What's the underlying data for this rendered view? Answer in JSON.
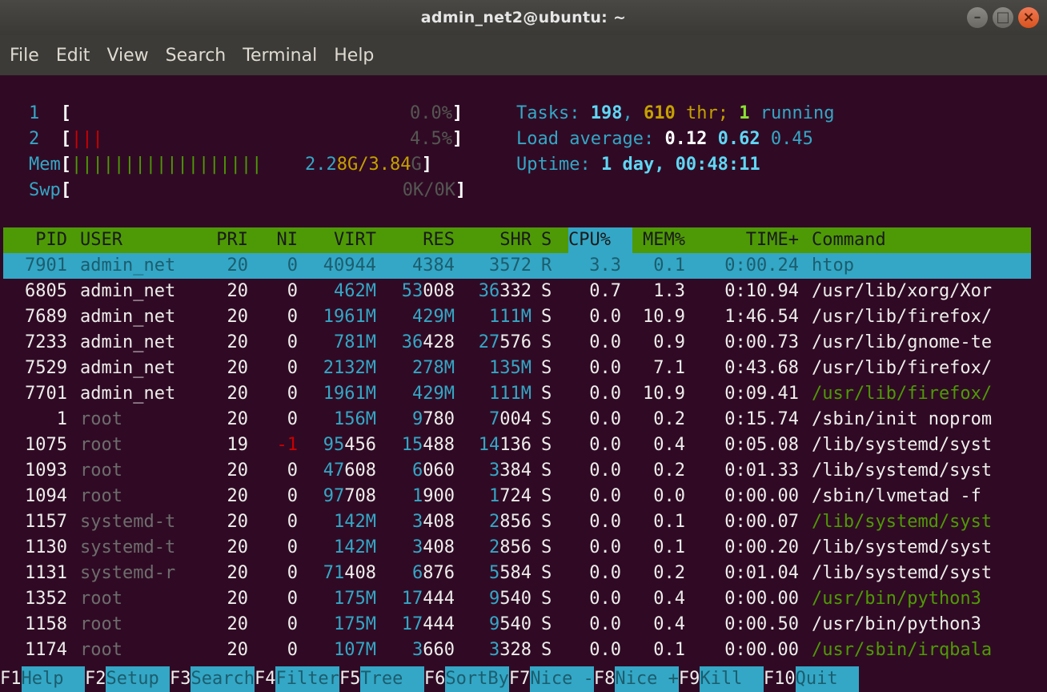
{
  "window": {
    "title": "admin_net2@ubuntu: ~",
    "buttons": {
      "minimize": "–",
      "maximize": "□",
      "close": "×"
    }
  },
  "menu": [
    "File",
    "Edit",
    "View",
    "Search",
    "Terminal",
    "Help"
  ],
  "meters": {
    "cpu1": {
      "label": "1",
      "bar": "",
      "value": "0.0%"
    },
    "cpu2": {
      "label": "2",
      "bar": "|||",
      "value": "4.5%"
    },
    "mem": {
      "label": "Mem",
      "bar": "||||||||||||||||||",
      "used_prefix": "2.2",
      "used_suffix": "8G",
      "total": "3.84",
      "total_suffix": "G"
    },
    "swp": {
      "label": "Swp",
      "value": "0K/0K"
    }
  },
  "stats": {
    "tasks_label": "Tasks:",
    "tasks": "198",
    "threads": "610",
    "thr_label": "thr;",
    "running": "1",
    "running_label": "running",
    "load_label": "Load average:",
    "load1": "0.12",
    "load5": "0.62",
    "load15": "0.45",
    "uptime_label": "Uptime:",
    "uptime": "1 day, 00:48:11"
  },
  "columns": [
    "PID",
    "USER",
    "PRI",
    "NI",
    "VIRT",
    "RES",
    "SHR",
    "S",
    "CPU%",
    "MEM%",
    "TIME+",
    "Command"
  ],
  "processes": [
    {
      "pid": "7901",
      "user": "admin_net",
      "pri": "20",
      "ni": "0",
      "virt": "40944",
      "res": "4384",
      "shr": "3572",
      "s": "R",
      "cpu": "3.3",
      "mem": "0.1",
      "time": "0:00.24",
      "cmd": "htop"
    },
    {
      "pid": "6805",
      "user": "admin_net",
      "pri": "20",
      "ni": "0",
      "virt": "462M",
      "res": "53008",
      "shr": "36332",
      "s": "S",
      "cpu": "0.7",
      "mem": "1.3",
      "time": "0:10.94",
      "cmd": "/usr/lib/xorg/Xor"
    },
    {
      "pid": "7689",
      "user": "admin_net",
      "pri": "20",
      "ni": "0",
      "virt": "1961M",
      "res": "429M",
      "shr": "111M",
      "s": "S",
      "cpu": "0.0",
      "mem": "10.9",
      "time": "1:46.54",
      "cmd": "/usr/lib/firefox/"
    },
    {
      "pid": "7233",
      "user": "admin_net",
      "pri": "20",
      "ni": "0",
      "virt": "781M",
      "res": "36428",
      "shr": "27576",
      "s": "S",
      "cpu": "0.0",
      "mem": "0.9",
      "time": "0:00.73",
      "cmd": "/usr/lib/gnome-te"
    },
    {
      "pid": "7529",
      "user": "admin_net",
      "pri": "20",
      "ni": "0",
      "virt": "2132M",
      "res": "278M",
      "shr": "135M",
      "s": "S",
      "cpu": "0.0",
      "mem": "7.1",
      "time": "0:43.68",
      "cmd": "/usr/lib/firefox/"
    },
    {
      "pid": "7701",
      "user": "admin_net",
      "pri": "20",
      "ni": "0",
      "virt": "1961M",
      "res": "429M",
      "shr": "111M",
      "s": "S",
      "cpu": "0.0",
      "mem": "10.9",
      "time": "0:09.41",
      "cmd": "/usr/lib/firefox/"
    },
    {
      "pid": "1",
      "user": "root",
      "pri": "20",
      "ni": "0",
      "virt": "156M",
      "res": "9780",
      "shr": "7004",
      "s": "S",
      "cpu": "0.0",
      "mem": "0.2",
      "time": "0:15.74",
      "cmd": "/sbin/init noprom"
    },
    {
      "pid": "1075",
      "user": "root",
      "pri": "19",
      "ni": "-1",
      "virt": "95456",
      "res": "15488",
      "shr": "14136",
      "s": "S",
      "cpu": "0.0",
      "mem": "0.4",
      "time": "0:05.08",
      "cmd": "/lib/systemd/syst"
    },
    {
      "pid": "1093",
      "user": "root",
      "pri": "20",
      "ni": "0",
      "virt": "47608",
      "res": "6060",
      "shr": "3384",
      "s": "S",
      "cpu": "0.0",
      "mem": "0.2",
      "time": "0:01.33",
      "cmd": "/lib/systemd/syst"
    },
    {
      "pid": "1094",
      "user": "root",
      "pri": "20",
      "ni": "0",
      "virt": "97708",
      "res": "1900",
      "shr": "1724",
      "s": "S",
      "cpu": "0.0",
      "mem": "0.0",
      "time": "0:00.00",
      "cmd": "/sbin/lvmetad -f"
    },
    {
      "pid": "1157",
      "user": "systemd-t",
      "pri": "20",
      "ni": "0",
      "virt": "142M",
      "res": "3408",
      "shr": "2856",
      "s": "S",
      "cpu": "0.0",
      "mem": "0.1",
      "time": "0:00.07",
      "cmd": "/lib/systemd/syst"
    },
    {
      "pid": "1130",
      "user": "systemd-t",
      "pri": "20",
      "ni": "0",
      "virt": "142M",
      "res": "3408",
      "shr": "2856",
      "s": "S",
      "cpu": "0.0",
      "mem": "0.1",
      "time": "0:00.20",
      "cmd": "/lib/systemd/syst"
    },
    {
      "pid": "1131",
      "user": "systemd-r",
      "pri": "20",
      "ni": "0",
      "virt": "71408",
      "res": "6876",
      "shr": "5584",
      "s": "S",
      "cpu": "0.0",
      "mem": "0.2",
      "time": "0:01.04",
      "cmd": "/lib/systemd/syst"
    },
    {
      "pid": "1352",
      "user": "root",
      "pri": "20",
      "ni": "0",
      "virt": "175M",
      "res": "17444",
      "shr": "9540",
      "s": "S",
      "cpu": "0.0",
      "mem": "0.4",
      "time": "0:00.00",
      "cmd": "/usr/bin/python3"
    },
    {
      "pid": "1158",
      "user": "root",
      "pri": "20",
      "ni": "0",
      "virt": "175M",
      "res": "17444",
      "shr": "9540",
      "s": "S",
      "cpu": "0.0",
      "mem": "0.4",
      "time": "0:00.50",
      "cmd": "/usr/bin/python3"
    },
    {
      "pid": "1174",
      "user": "root",
      "pri": "20",
      "ni": "0",
      "virt": "107M",
      "res": "3660",
      "shr": "3328",
      "s": "S",
      "cpu": "0.0",
      "mem": "0.1",
      "time": "0:00.00",
      "cmd": "/usr/sbin/irqbala"
    }
  ],
  "fkeys": [
    {
      "key": "F1",
      "label": "Help  "
    },
    {
      "key": "F2",
      "label": "Setup "
    },
    {
      "key": "F3",
      "label": "Search"
    },
    {
      "key": "F4",
      "label": "Filter"
    },
    {
      "key": "F5",
      "label": "Tree  "
    },
    {
      "key": "F6",
      "label": "SortBy"
    },
    {
      "key": "F7",
      "label": "Nice -"
    },
    {
      "key": "F8",
      "label": "Nice +"
    },
    {
      "key": "F9",
      "label": "Kill  "
    },
    {
      "key": "F10",
      "label": "Quit  "
    }
  ]
}
